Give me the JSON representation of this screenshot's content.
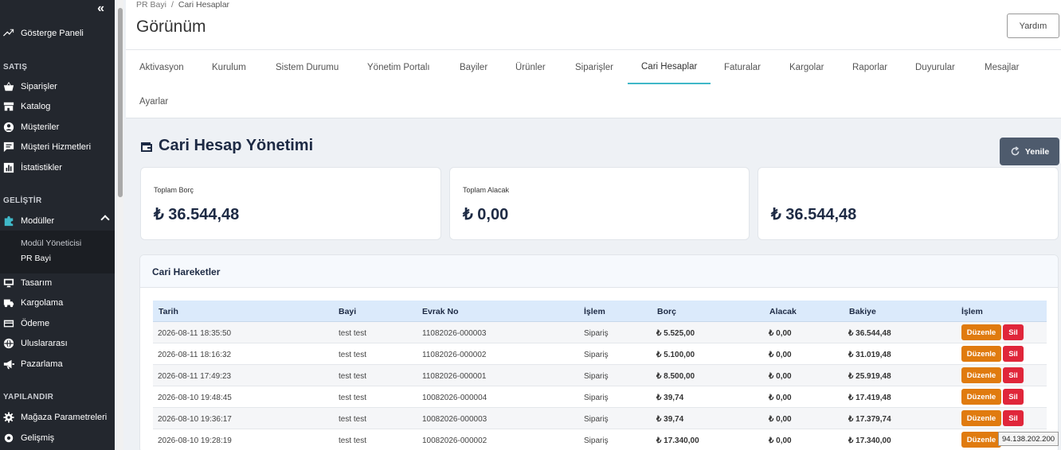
{
  "sidebar": {
    "collapse_glyph": "«",
    "dashboard": "Gösterge Paneli",
    "section_sales": "SATIŞ",
    "orders": "Siparişler",
    "catalog": "Katalog",
    "customers": "Müşteriler",
    "customer_service": "Müşteri Hizmetleri",
    "statistics": "İstatistikler",
    "section_develop": "GELİŞTİR",
    "modules": "Modüller",
    "module_manager": "Modül Yöneticisi",
    "pr_bayi": "PR Bayi",
    "design": "Tasarım",
    "shipping": "Kargolama",
    "payment": "Ödeme",
    "international": "Uluslararası",
    "marketing": "Pazarlama",
    "section_configure": "YAPILANDIR",
    "shop_params": "Mağaza Parametreleri",
    "advanced": "Gelişmiş"
  },
  "header": {
    "breadcrumb_parent": "PR Bayi",
    "breadcrumb_sep": "/",
    "breadcrumb_current": "Cari Hesaplar",
    "title": "Görünüm",
    "help": "Yardım"
  },
  "tabs": [
    "Aktivasyon",
    "Kurulum",
    "Sistem Durumu",
    "Yönetim Portalı",
    "Bayiler",
    "Ürünler",
    "Siparişler",
    "Cari Hesaplar",
    "Faturalar",
    "Kargolar",
    "Raporlar",
    "Duyurular",
    "Mesajlar",
    "Ayarlar"
  ],
  "main": {
    "title": "Cari Hesap Yönetimi",
    "refresh": "Yenile",
    "cards": [
      {
        "label": "Toplam Borç",
        "value": "₺ 36.544,48"
      },
      {
        "label": "Toplam Alacak",
        "value": "₺ 0,00"
      },
      {
        "label": "",
        "value": "₺ 36.544,48"
      }
    ],
    "panel_title": "Cari Hareketler"
  },
  "table": {
    "headers": [
      "Tarih",
      "Bayi",
      "Evrak No",
      "İşlem",
      "Borç",
      "Alacak",
      "Bakiye",
      "İşlem"
    ],
    "rows": [
      {
        "date": "2026-08-11 18:35:50",
        "dealer": "test test",
        "doc": "11082026-000003",
        "type": "Sipariş",
        "debit": "₺ 5.525,00",
        "credit": "₺ 0,00",
        "balance": "₺ 36.544,48"
      },
      {
        "date": "2026-08-11 18:16:32",
        "dealer": "test test",
        "doc": "11082026-000002",
        "type": "Sipariş",
        "debit": "₺ 5.100,00",
        "credit": "₺ 0,00",
        "balance": "₺ 31.019,48"
      },
      {
        "date": "2026-08-11 17:49:23",
        "dealer": "test test",
        "doc": "11082026-000001",
        "type": "Sipariş",
        "debit": "₺ 8.500,00",
        "credit": "₺ 0,00",
        "balance": "₺ 25.919,48"
      },
      {
        "date": "2026-08-10 19:48:45",
        "dealer": "test test",
        "doc": "10082026-000004",
        "type": "Sipariş",
        "debit": "₺ 39,74",
        "credit": "₺ 0,00",
        "balance": "₺ 17.419,48"
      },
      {
        "date": "2026-08-10 19:36:17",
        "dealer": "test test",
        "doc": "10082026-000003",
        "type": "Sipariş",
        "debit": "₺ 39,74",
        "credit": "₺ 0,00",
        "balance": "₺ 17.379,74"
      },
      {
        "date": "2026-08-10 19:28:19",
        "dealer": "test test",
        "doc": "10082026-000002",
        "type": "Sipariş",
        "debit": "₺ 17.340,00",
        "credit": "₺ 0,00",
        "balance": "₺ 17.340,00"
      }
    ],
    "edit": "Düzenle",
    "delete": "Sil"
  },
  "tooltip_ip": "94.138.202.200"
}
